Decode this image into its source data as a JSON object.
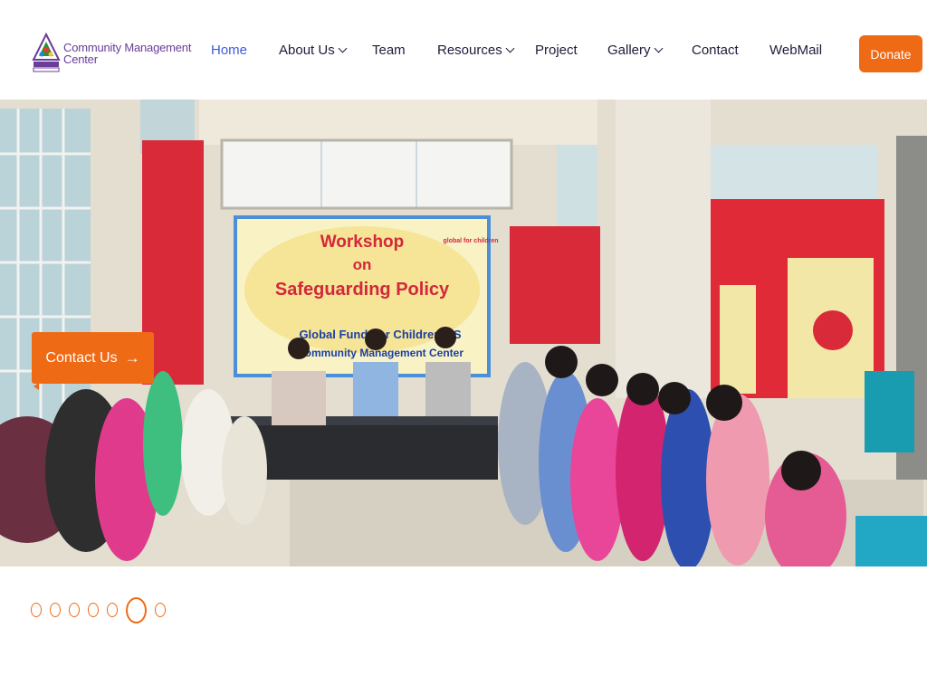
{
  "brand": {
    "name_line1": "Community Management",
    "name_line2": "Center"
  },
  "nav": {
    "home": "Home",
    "about": "About Us",
    "team": "Team",
    "resources": "Resources",
    "project": "Project",
    "gallery": "Gallery",
    "contact": "Contact",
    "webmail": "WebMail"
  },
  "donate_label": "Donate",
  "hero": {
    "banner_title_line1": "Workshop",
    "banner_title_line2": "on",
    "banner_title_line3": "Safeguarding Policy",
    "banner_funding": "Global Fund For Children-US",
    "banner_org": "Community Management Center",
    "banner_partner": "global for children",
    "contact_label": "Contact Us",
    "contact_arrow": "→"
  },
  "slider": {
    "count": 7,
    "active_index": 5
  },
  "colors": {
    "accent": "#ef6a15",
    "nav_active": "#3d5bd9",
    "brand_purple": "#6a3d9a"
  }
}
